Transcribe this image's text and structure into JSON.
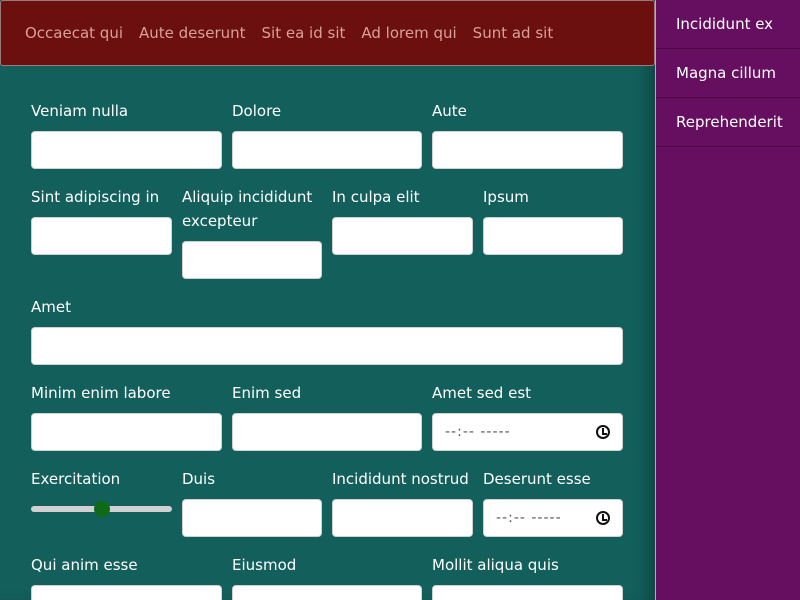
{
  "topnav": {
    "links": [
      "Occaecat qui",
      "Aute deserunt",
      "Sit ea id sit",
      "Ad lorem qui",
      "Sunt ad sit"
    ]
  },
  "sidebar": {
    "items": [
      "Incididunt ex",
      "Magna cillum",
      "Reprehenderit"
    ]
  },
  "form": {
    "row1": {
      "f1": "Veniam nulla",
      "f2": "Dolore",
      "f3": "Aute"
    },
    "row2": {
      "f1": "Sint adipiscing in",
      "f2": "Aliquip incididunt excepteur",
      "f3": "In culpa elit",
      "f4": "Ipsum"
    },
    "row3": {
      "f1": "Amet"
    },
    "row4": {
      "f1": "Minim enim labore",
      "f2": "Enim sed",
      "f3": "Amet sed est",
      "f3_placeholder": "--:-- -----"
    },
    "row5": {
      "f1": "Exercitation",
      "f1_value_fraction": 0.5,
      "f2": "Duis",
      "f3": "Incididunt nostrud",
      "f4": "Deserunt esse",
      "f4_placeholder": "--:-- -----"
    },
    "row6": {
      "f1": "Qui anim esse",
      "f2": "Eiusmod",
      "f3": "Mollit aliqua quis"
    }
  },
  "colors": {
    "topbar": "#6b0f0f",
    "main": "#135f5c",
    "sidebar": "#660f61",
    "slider_thumb": "#0f6a18"
  }
}
